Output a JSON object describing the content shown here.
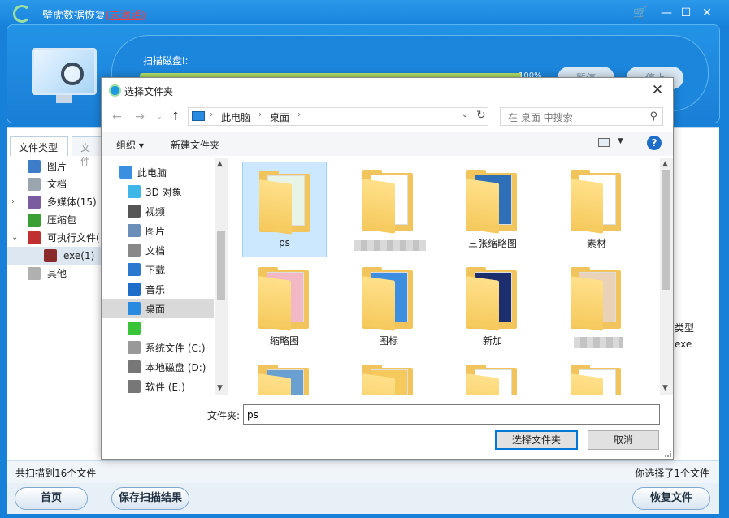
{
  "app": {
    "title": "壁虎数据恢复",
    "unregistered": "(未激活)",
    "scan_label": "扫描磁盘I:",
    "progress_fraction": 1.0,
    "progress_text": "100%",
    "pause_btn": "暂停",
    "stop_btn": "停止",
    "left_tabs": [
      "文件类型",
      "文件"
    ],
    "tree": [
      {
        "label": "图片",
        "icon": "picture-icon",
        "color": "#3d7cc9"
      },
      {
        "label": "文档",
        "icon": "document-icon",
        "color": "#9aa5b0"
      },
      {
        "label": "多媒体(15)",
        "icon": "music-icon",
        "color": "#7a5ca0",
        "arrow": "›"
      },
      {
        "label": "压缩包",
        "icon": "archive-icon",
        "color": "#3aa035"
      },
      {
        "label": "可执行文件(",
        "icon": "executable-icon",
        "color": "#c03030",
        "arrow": "⌄"
      },
      {
        "label": "exe(1)",
        "icon": "exe-icon",
        "color": "#8b2a2a"
      },
      {
        "label": "其他",
        "icon": "other-icon",
        "color": "#b0b0b0"
      }
    ],
    "right_col": {
      "header": "类型",
      "value": "exe"
    },
    "status_left": "共扫描到16个文件",
    "status_right": "你选择了1个文件",
    "home_btn": "首页",
    "save_btn": "保存扫描结果",
    "recover_btn": "恢复文件",
    "colors": {
      "titlebar": "#1e8ce0",
      "accent": "#1780d8"
    }
  },
  "dialog": {
    "title": "选择文件夹",
    "breadcrumb": [
      "此电脑",
      "桌面"
    ],
    "search_placeholder": "在 桌面 中搜索",
    "toolbar": {
      "organize": "组织 ▾",
      "new_folder": "新建文件夹"
    },
    "nav": [
      {
        "label": "此电脑",
        "icon": "this-pc-icon"
      },
      {
        "label": "3D 对象",
        "icon": "3d-objects-icon"
      },
      {
        "label": "视频",
        "icon": "videos-icon"
      },
      {
        "label": "图片",
        "icon": "pictures-icon"
      },
      {
        "label": "文档",
        "icon": "documents-icon"
      },
      {
        "label": "下载",
        "icon": "downloads-icon"
      },
      {
        "label": "音乐",
        "icon": "music-icon"
      },
      {
        "label": "桌面",
        "icon": "desktop-icon",
        "selected": true
      },
      {
        "label": "",
        "icon": "wechat-icon"
      },
      {
        "label": "系统文件 (C:)",
        "icon": "drive-c-icon"
      },
      {
        "label": "本地磁盘 (D:)",
        "icon": "drive-d-icon"
      },
      {
        "label": "软件 (E:)",
        "icon": "drive-e-icon"
      }
    ],
    "folders": [
      {
        "label": "ps",
        "selected": true,
        "art": "#e8f4e6"
      },
      {
        "label": "",
        "blurred": true,
        "art": "#ffffff"
      },
      {
        "label": "三张缩略图",
        "art": "#2f6fb8"
      },
      {
        "label": "素材",
        "art": "#ffffff"
      },
      {
        "label": "缩略图",
        "art": "#f2b8c6"
      },
      {
        "label": "图标",
        "art": "#3d8de0"
      },
      {
        "label": "新加",
        "art": "#1c2e6e"
      },
      {
        "label": "",
        "blurred": true,
        "art": "#e9d2b8"
      },
      {
        "label": "",
        "art": "#6aa0d0"
      },
      {
        "label": "",
        "art": "#f5c95c"
      },
      {
        "label": "",
        "art": "#ffffff"
      },
      {
        "label": "",
        "art": "#ffffff"
      }
    ],
    "filename_label": "文件夹:",
    "filename_value": "ps",
    "select_btn": "选择文件夹",
    "cancel_btn": "取消"
  }
}
